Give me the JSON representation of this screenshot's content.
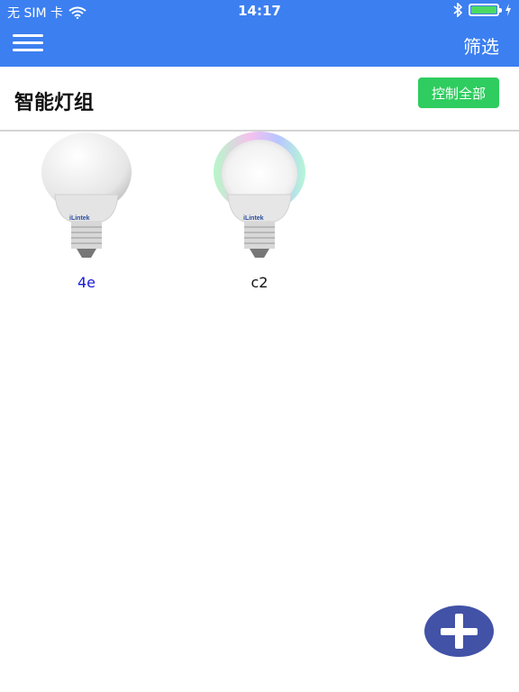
{
  "status_bar": {
    "carrier": "无 SIM 卡",
    "time": "14:17",
    "wifi_icon": "wifi-icon",
    "bluetooth_icon": "bluetooth-icon",
    "battery_icon": "battery-icon",
    "charging_icon": "charging-icon"
  },
  "nav": {
    "menu_icon": "hamburger-menu-icon",
    "filter_label": "筛选",
    "bar_color": "#3c7ff0"
  },
  "header": {
    "title": "智能灯组",
    "control_all_label": "控制全部",
    "control_all_color": "#2fcc5f"
  },
  "devices": [
    {
      "name": "4e",
      "name_color": "#1a1ad6",
      "bulb_brand": "iLintek",
      "bulb_type": "white"
    },
    {
      "name": "c2",
      "name_color": "#111111",
      "bulb_brand": "iLintek",
      "bulb_type": "rgb"
    }
  ],
  "fab": {
    "icon": "plus-icon",
    "color": "#4252a7"
  }
}
